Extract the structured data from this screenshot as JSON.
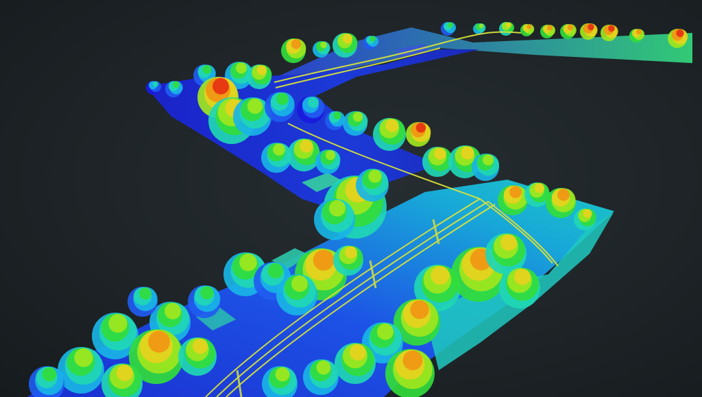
{
  "scene": {
    "kind": "lidar-point-cloud",
    "color_ramp": [
      "#1a1adc",
      "#1f5cf0",
      "#19b4e6",
      "#1fd7b4",
      "#32dc3c",
      "#a0e61e",
      "#e6d21e",
      "#f09614",
      "#e63214"
    ],
    "background": "#1c2124",
    "features": {
      "ground": "ground-plane",
      "vegetation": "tree-canopies",
      "powerlines": "power-line-corridor",
      "structures": "buildings"
    }
  }
}
